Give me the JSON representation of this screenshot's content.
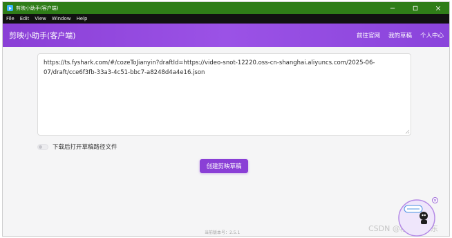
{
  "window": {
    "title": "剪映小助手(客户端)",
    "titlebar_color": "#2f7d18",
    "icons": {
      "app": "app-logo-icon",
      "minimize": "minimize-icon",
      "maximize": "maximize-icon",
      "close": "close-icon"
    }
  },
  "menu": {
    "items": [
      "File",
      "Edit",
      "View",
      "Window",
      "Help"
    ]
  },
  "header": {
    "title": "剪映小助手(客户端)",
    "background": "#8a3fd6",
    "nav": [
      "前往官网",
      "我的草稿",
      "个人中心"
    ]
  },
  "main": {
    "url_text": "https://ts.fyshark.com/#/cozeToJianyin?draftId=https://video-snot-12220.oss-cn-shanghai.aliyuncs.com/2025-06-07/draft/cce6f3fb-33a3-4c51-bbc7-a8248d4a4e16.json",
    "toggle_label": "下载后打开草稿路径文件",
    "toggle_on": false,
    "create_button": "创建剪映草稿",
    "accent_color": "#8a3fd6"
  },
  "footer": {
    "version": "当前版本号：2.5.1"
  },
  "overlay": {
    "watermark": "CSDN @程序员一东",
    "widget_icon": "assistant-robot-icon",
    "widget_close_icon": "close-circle-icon"
  }
}
